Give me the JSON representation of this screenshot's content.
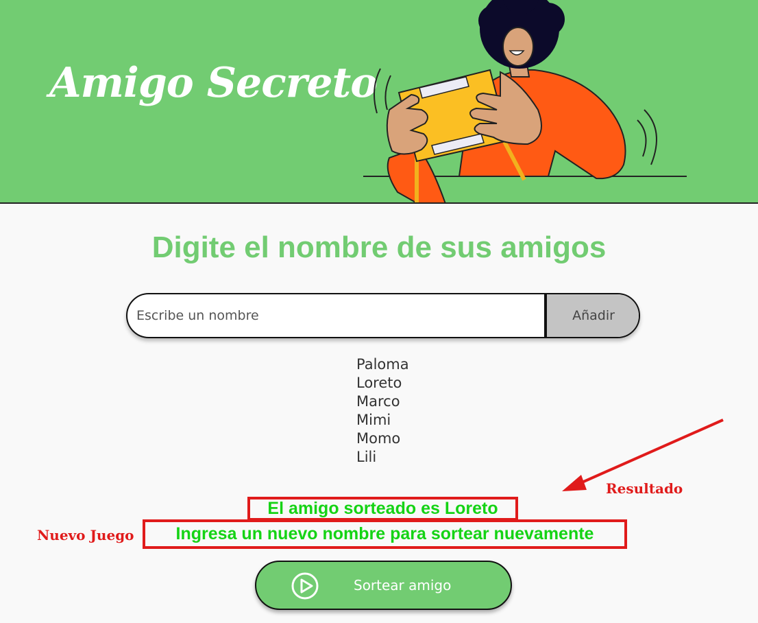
{
  "header": {
    "title": "Amigo Secreto",
    "illustration_icon": "person-holding-gift-illustration"
  },
  "main": {
    "heading": "Digite el nombre de sus amigos",
    "input": {
      "value": "",
      "placeholder": "Escribe un nombre"
    },
    "add_button_label": "Añadir",
    "friends": [
      "Paloma",
      "Loreto",
      "Marco",
      "Mimi",
      "Momo",
      "Lili"
    ],
    "result_text": "El amigo sorteado es Loreto",
    "new_game_text": "Ingresa un nuevo nombre para sortear nuevamente",
    "draw_button_label": "Sortear amigo",
    "draw_button_icon": "play-circle-icon"
  },
  "annotations": {
    "result_label": "Resultado",
    "new_game_label": "Nuevo Juego"
  },
  "colors": {
    "brand_green": "#72cc72",
    "result_green": "#15d315",
    "annotation_red": "#e01b1b",
    "add_button_bg": "#c4c4c4"
  }
}
